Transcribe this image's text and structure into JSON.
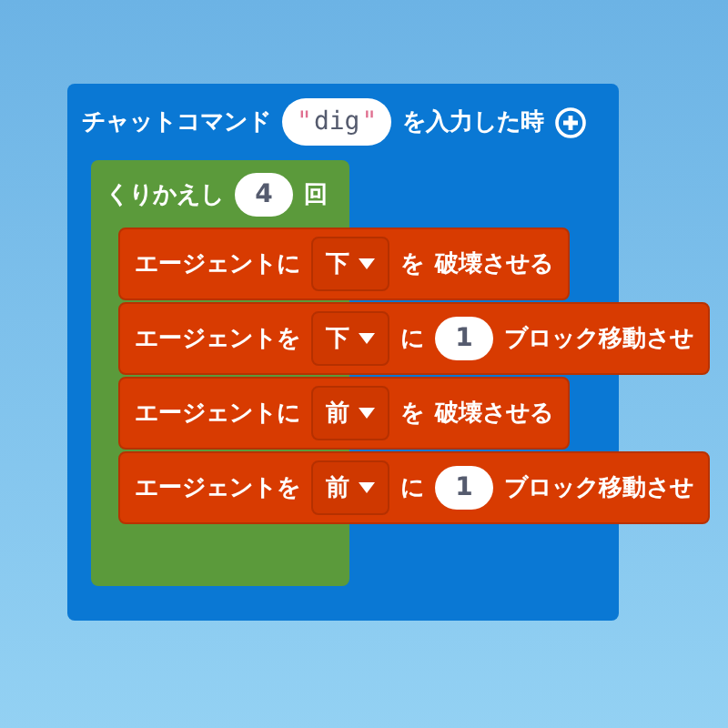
{
  "event_block": {
    "label": "チャットコマンド",
    "command": {
      "open_quote": "\"",
      "value": "dig",
      "close_quote": "\""
    },
    "suffix": "を入力した時",
    "loop": {
      "label": "くりかえし",
      "count": "4",
      "unit": "回",
      "blocks": [
        {
          "kind": "destroy",
          "label": "エージェントに",
          "direction": "下",
          "particle": "を",
          "action": "破壊させる"
        },
        {
          "kind": "move",
          "label": "エージェントを",
          "direction": "下",
          "particle": "に",
          "count": "1",
          "action": "ブロック移動させ"
        },
        {
          "kind": "destroy",
          "label": "エージェントに",
          "direction": "前",
          "particle": "を",
          "action": "破壊させる"
        },
        {
          "kind": "move",
          "label": "エージェントを",
          "direction": "前",
          "particle": "に",
          "count": "1",
          "action": "ブロック移動させ"
        }
      ]
    }
  }
}
